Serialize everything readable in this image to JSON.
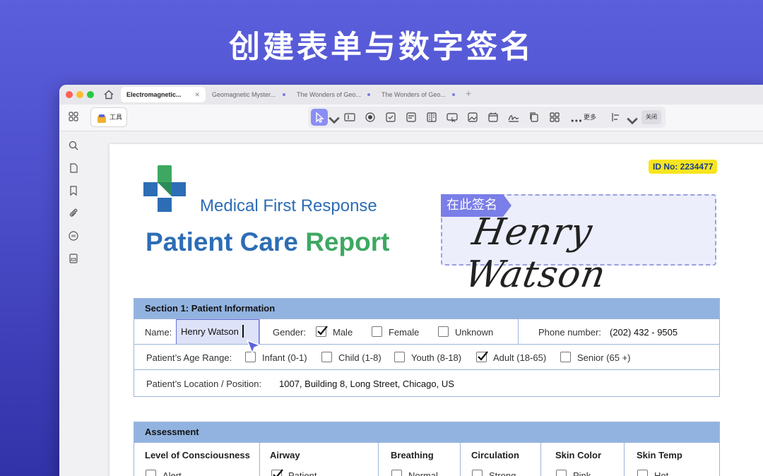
{
  "headline": "创建表单与数字签名",
  "tabs": [
    {
      "label": "Electromagnetic...",
      "active": true
    },
    {
      "label": "Geomagnetic Myster...",
      "active": false
    },
    {
      "label": "The Wonders of Geo...",
      "active": false
    },
    {
      "label": "The Wonders of Geo...",
      "active": false
    }
  ],
  "toolbar": {
    "tools_label": "工具",
    "more_label": "更多",
    "close_label": "关闭"
  },
  "icons": {
    "sidebar": [
      "search-icon",
      "page-icon",
      "bookmark-icon",
      "attachment-icon",
      "comment-icon",
      "form-icon"
    ],
    "toolgroup": [
      "select-icon",
      "text-field-icon",
      "radio-icon",
      "checkbox-icon",
      "combo-icon",
      "list-icon",
      "button-icon",
      "image-icon",
      "date-icon",
      "signature-icon",
      "copy-icon",
      "grid-icon"
    ]
  },
  "colors": {
    "accent": "#7a7ee8",
    "brand_blue": "#2d6db5",
    "brand_green": "#3ea862",
    "section_header": "#92b3e0"
  },
  "document": {
    "org_name": "Medical First Response",
    "title_part1": "Patient Care",
    "title_part2": "Report",
    "id_badge": "ID No: 2234477",
    "signature_tag": "在此签名",
    "signature": "Henry Watson",
    "section1": {
      "title": "Section 1: Patient Information",
      "name_label": "Name:",
      "name_value": "Henry Watson",
      "gender_label": "Gender:",
      "gender_options": [
        {
          "label": "Male",
          "checked": true
        },
        {
          "label": "Female",
          "checked": false
        },
        {
          "label": "Unknown",
          "checked": false
        }
      ],
      "phone_label": "Phone number:",
      "phone_value": "(202) 432 - 9505",
      "age_label": "Patient’s Age Range:",
      "age_options": [
        {
          "label": "Infant (0-1)",
          "checked": false
        },
        {
          "label": "Child (1-8)",
          "checked": false
        },
        {
          "label": "Youth (8-18)",
          "checked": false
        },
        {
          "label": "Adult (18-65)",
          "checked": true
        },
        {
          "label": "Senior (65 +)",
          "checked": false
        }
      ],
      "location_label": "Patient’s Location / Position:",
      "location_value": "1007, Building 8, Long Street, Chicago, US"
    },
    "assessment": {
      "title": "Assessment",
      "columns": [
        {
          "label": "Level of Consciousness",
          "first_option": "Alert",
          "checked": false
        },
        {
          "label": "Airway",
          "first_option": "Patient",
          "checked": true
        },
        {
          "label": "Breathing",
          "first_option": "Normal",
          "checked": false
        },
        {
          "label": "Circulation",
          "first_option": "Strong",
          "checked": false
        },
        {
          "label": "Skin Color",
          "first_option": "Pink",
          "checked": false
        },
        {
          "label": "Skin Temp",
          "first_option": "Hot",
          "checked": false
        }
      ]
    }
  }
}
